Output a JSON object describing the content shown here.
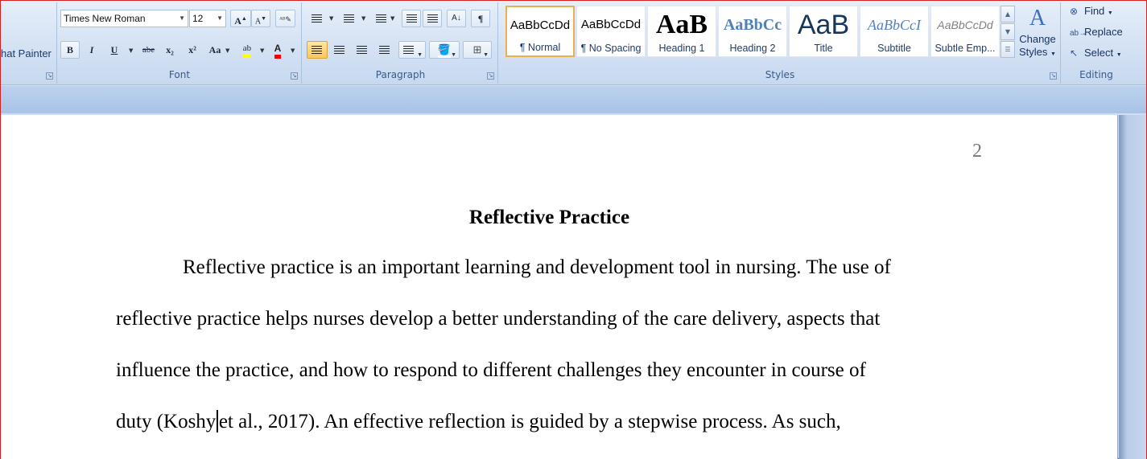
{
  "clipboard": {
    "format_painter_label": "hat Painter"
  },
  "font": {
    "group_label": "Font",
    "name": "Times New Roman",
    "size": "12",
    "bold": "B",
    "italic": "I",
    "underline": "U",
    "strikethrough": "abe",
    "subscript": "x₂",
    "superscript": "x²",
    "change_case": "Aa",
    "grow": "A",
    "shrink": "A",
    "highlight": "ab",
    "font_color": "A"
  },
  "paragraph": {
    "group_label": "Paragraph",
    "show_marks": "¶"
  },
  "styles": {
    "group_label": "Styles",
    "items": [
      {
        "sample": "AaBbCcDd",
        "name": "¶ Normal"
      },
      {
        "sample": "AaBbCcDd",
        "name": "¶ No Spacing"
      },
      {
        "sample": "AaB",
        "name": "Heading 1"
      },
      {
        "sample": "AaBbCc",
        "name": "Heading 2"
      },
      {
        "sample": "AaB",
        "name": "Title"
      },
      {
        "sample": "AaBbCcI",
        "name": "Subtitle"
      },
      {
        "sample": "AaBbCcDd",
        "name": "Subtle Emp..."
      }
    ],
    "change_styles_line1": "Change",
    "change_styles_line2": "Styles"
  },
  "editing": {
    "group_label": "Editing",
    "find": "Find",
    "replace": "Replace",
    "select": "Select"
  },
  "document": {
    "page_number": "2",
    "title": "Reflective Practice",
    "lines": [
      "Reflective practice is an important learning and development tool in nursing. The use of",
      "reflective practice helps nurses develop a better understanding of the care delivery, aspects that",
      "influence the practice, and how to respond to different challenges they encounter in course of"
    ],
    "last_line_before_caret": "duty (Koshy",
    "last_line_after_caret": "et al., 2017). An effective reflection is guided by a stepwise process. As such,"
  },
  "colors": {
    "accent": "#e9b04d",
    "ribbon": "#d3e1f3",
    "highlight_yellow": "#ffff00",
    "font_red": "#ff0000"
  }
}
